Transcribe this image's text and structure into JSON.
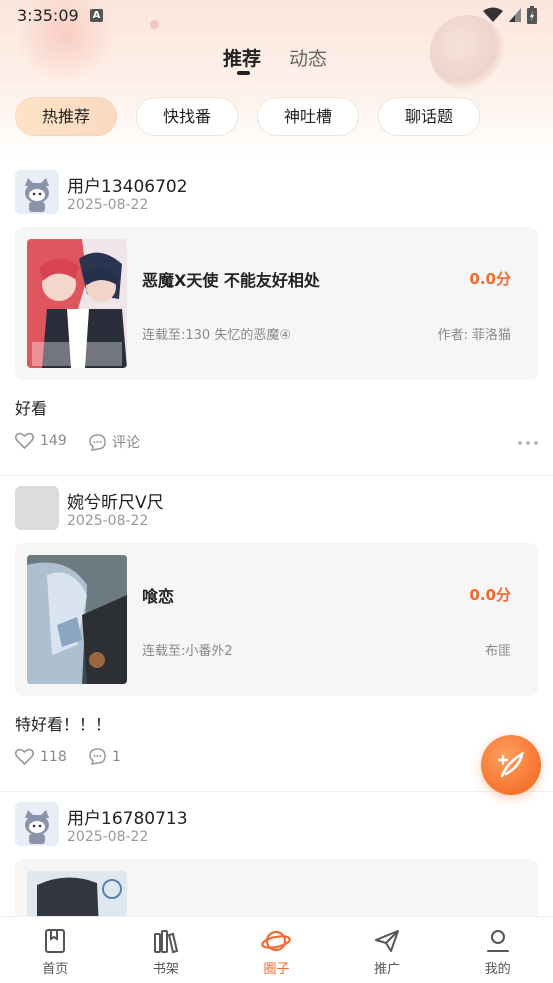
{
  "status_bar": {
    "time": "3:35:09",
    "notif_letter": "A"
  },
  "top_tabs": {
    "active": "推荐",
    "inactive": "动态"
  },
  "chips": [
    "热推荐",
    "快找番",
    "神吐槽",
    "聊话题"
  ],
  "posts": [
    {
      "username": "用户13406702",
      "date": "2025-08-22",
      "book": {
        "title": "恶魔X天使 不能友好相处",
        "score": "0.0分",
        "serial": "连载至:130 失忆的恶魔④",
        "author": "作者: 菲洛猫"
      },
      "text": "好看",
      "likes": "149",
      "comment_label": "评论"
    },
    {
      "username": "婉兮昕尺V尺",
      "date": "2025-08-22",
      "book": {
        "title": "喰恋",
        "score": "0.0分",
        "serial": "连载至:小番外2",
        "author": "布匪"
      },
      "text": "特好看！！！",
      "likes": "118",
      "comment_label": "1"
    },
    {
      "username": "用户16780713",
      "date": "2025-08-22"
    }
  ],
  "bottom_nav": [
    "首页",
    "书架",
    "圈子",
    "推广",
    "我的"
  ],
  "colors": {
    "accent": "#f26a2e",
    "chip_active": "#fde4c7"
  },
  "icons": [
    "wifi-icon",
    "signal-icon",
    "battery-icon",
    "heart-icon",
    "comment-icon",
    "more-icon",
    "quill-icon",
    "home-icon",
    "bookshelf-icon",
    "planet-icon",
    "paper-plane-icon",
    "profile-icon"
  ]
}
